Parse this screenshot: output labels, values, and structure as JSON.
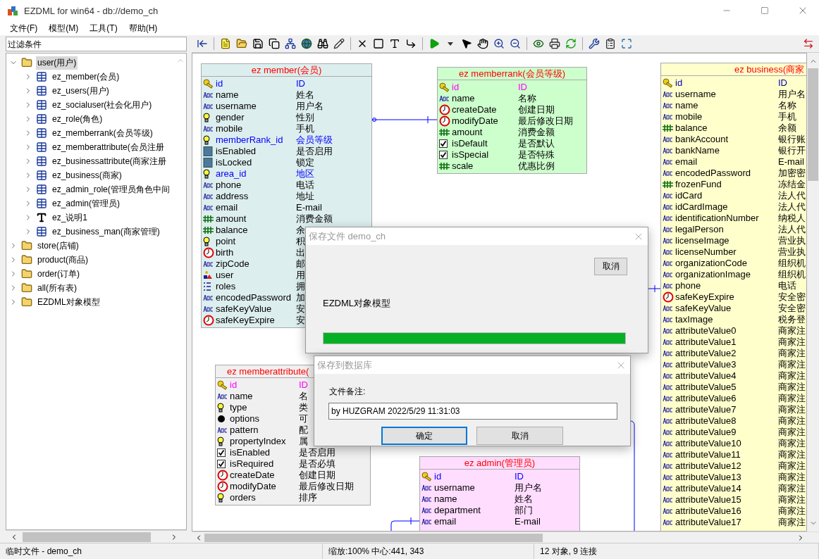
{
  "window": {
    "title": "EZDML for win64 - db://demo_ch"
  },
  "menu": [
    "文件(F)",
    "模型(M)",
    "工具(T)",
    "帮助(H)"
  ],
  "filter": {
    "placeholder": "过滤条件"
  },
  "tree": [
    {
      "label": "user(用户)",
      "kind": "folder",
      "selected": true,
      "expanded": true,
      "children": [
        {
          "label": "ez_member(会员)",
          "kind": "table",
          "selected": false,
          "expanded": false
        },
        {
          "label": "ez_users(用户)",
          "kind": "table",
          "selected": false,
          "expanded": false
        },
        {
          "label": "ez_socialuser(社会化用户)",
          "kind": "table",
          "selected": false,
          "expanded": false
        },
        {
          "label": "ez_role(角色)",
          "kind": "table",
          "selected": false,
          "expanded": false
        },
        {
          "label": "ez_memberrank(会员等级)",
          "kind": "table",
          "selected": false,
          "expanded": false
        },
        {
          "label": "ez_memberattribute(会员注册",
          "kind": "table",
          "selected": false,
          "expanded": false
        },
        {
          "label": "ez_businessattribute(商家注册",
          "kind": "table",
          "selected": false,
          "expanded": false
        },
        {
          "label": "ez_business(商家)",
          "kind": "table",
          "selected": false,
          "expanded": false
        },
        {
          "label": "ez_admin_role(管理员角色中间",
          "kind": "table",
          "selected": false,
          "expanded": false
        },
        {
          "label": "ez_admin(管理员)",
          "kind": "table",
          "selected": false,
          "expanded": false
        },
        {
          "label": "ez_说明1",
          "kind": "text",
          "selected": false,
          "expanded": false
        },
        {
          "label": "ez_business_man(商家管理)",
          "kind": "table",
          "selected": false,
          "expanded": false
        }
      ]
    },
    {
      "label": "store(店铺)",
      "kind": "folder",
      "selected": false,
      "expanded": false
    },
    {
      "label": "product(商品)",
      "kind": "folder",
      "selected": false,
      "expanded": false
    },
    {
      "label": "order(订单)",
      "kind": "folder",
      "selected": false,
      "expanded": false
    },
    {
      "label": "all(所有表)",
      "kind": "folder",
      "selected": false,
      "expanded": false
    },
    {
      "label": "EZDML对象模型",
      "kind": "folder",
      "selected": false,
      "expanded": false
    }
  ],
  "diagram": {
    "tables": [
      {
        "title": "ez member(会员)",
        "color": "#ddeeee",
        "cut_right": false,
        "cut_bottom": false,
        "fields": [
          {
            "name": "id",
            "comment": "ID",
            "kind": "key",
            "color": "#0000ff"
          },
          {
            "name": "name",
            "comment": "姓名",
            "kind": "text",
            "color": "#000000"
          },
          {
            "name": "username",
            "comment": "用户名",
            "kind": "text",
            "color": "#000000"
          },
          {
            "name": "gender",
            "comment": "性别",
            "kind": "bulb",
            "color": "#000000"
          },
          {
            "name": "mobile",
            "comment": "手机",
            "kind": "text",
            "color": "#000000"
          },
          {
            "name": "memberRank_id",
            "comment": "会员等级",
            "kind": "bulb",
            "color": "#0000ff"
          },
          {
            "name": "isEnabled",
            "comment": "是否启用",
            "kind": "bool",
            "color": "#000000"
          },
          {
            "name": "isLocked",
            "comment": "锁定",
            "kind": "bool",
            "color": "#000000"
          },
          {
            "name": "area_id",
            "comment": "地区",
            "kind": "bulb",
            "color": "#0000ff"
          },
          {
            "name": "phone",
            "comment": "电话",
            "kind": "text",
            "color": "#000000"
          },
          {
            "name": "address",
            "comment": "地址",
            "kind": "text",
            "color": "#000000"
          },
          {
            "name": "email",
            "comment": "E-mail",
            "kind": "text",
            "color": "#000000"
          },
          {
            "name": "amount",
            "comment": "消费金额",
            "kind": "number",
            "color": "#000000"
          },
          {
            "name": "balance",
            "comment": "余",
            "kind": "number",
            "color": "#000000"
          },
          {
            "name": "point",
            "comment": "积",
            "kind": "bulb",
            "color": "#000000"
          },
          {
            "name": "birth",
            "comment": "出",
            "kind": "date",
            "color": "#000000"
          },
          {
            "name": "zipCode",
            "comment": "邮",
            "kind": "text",
            "color": "#000000"
          },
          {
            "name": "user",
            "comment": "用",
            "kind": "object",
            "color": "#000000"
          },
          {
            "name": "roles",
            "comment": "拥",
            "kind": "list",
            "color": "#000000"
          },
          {
            "name": "encodedPassword",
            "comment": "加",
            "kind": "text",
            "color": "#000000"
          },
          {
            "name": "safeKeyValue",
            "comment": "安",
            "kind": "text",
            "color": "#000000"
          },
          {
            "name": "safeKeyExpire",
            "comment": "安",
            "kind": "date",
            "color": "#000000"
          }
        ]
      },
      {
        "title": "ez memberrank(会员等级)",
        "color": "#ccffcc",
        "cut_right": false,
        "cut_bottom": false,
        "fields": [
          {
            "name": "id",
            "comment": "ID",
            "kind": "key",
            "color": "#ff00ff"
          },
          {
            "name": "name",
            "comment": "名称",
            "kind": "text",
            "color": "#000000"
          },
          {
            "name": "createDate",
            "comment": "创建日期",
            "kind": "date",
            "color": "#000000"
          },
          {
            "name": "modifyDate",
            "comment": "最后修改日期",
            "kind": "date",
            "color": "#000000"
          },
          {
            "name": "amount",
            "comment": "消费金额",
            "kind": "number",
            "color": "#000000"
          },
          {
            "name": "isDefault",
            "comment": "是否默认",
            "kind": "check",
            "color": "#000000"
          },
          {
            "name": "isSpecial",
            "comment": "是否特殊",
            "kind": "check",
            "color": "#000000"
          },
          {
            "name": "scale",
            "comment": "优惠比例",
            "kind": "number",
            "color": "#000000"
          }
        ]
      },
      {
        "title": "ez business(商家",
        "color": "#ffffcc",
        "cut_right": true,
        "cut_bottom": true,
        "fields": [
          {
            "name": "id",
            "comment": "ID",
            "kind": "key",
            "color": "#0000aa"
          },
          {
            "name": "username",
            "comment": "用户名",
            "kind": "text",
            "color": "#000000"
          },
          {
            "name": "name",
            "comment": "名称",
            "kind": "text",
            "color": "#000000"
          },
          {
            "name": "mobile",
            "comment": "手机",
            "kind": "text",
            "color": "#000000"
          },
          {
            "name": "balance",
            "comment": "余额",
            "kind": "number",
            "color": "#000000"
          },
          {
            "name": "bankAccount",
            "comment": "银行账",
            "kind": "text",
            "color": "#000000"
          },
          {
            "name": "bankName",
            "comment": "银行开",
            "kind": "text",
            "color": "#000000"
          },
          {
            "name": "email",
            "comment": "E-mail",
            "kind": "text",
            "color": "#000000"
          },
          {
            "name": "encodedPassword",
            "comment": "加密密",
            "kind": "text",
            "color": "#000000"
          },
          {
            "name": "frozenFund",
            "comment": "冻结金",
            "kind": "number",
            "color": "#000000"
          },
          {
            "name": "idCard",
            "comment": "法人代",
            "kind": "text",
            "color": "#000000"
          },
          {
            "name": "idCardImage",
            "comment": "法人代",
            "kind": "text",
            "color": "#000000"
          },
          {
            "name": "identificationNumber",
            "comment": "纳税人",
            "kind": "text",
            "color": "#000000"
          },
          {
            "name": "legalPerson",
            "comment": "法人代",
            "kind": "text",
            "color": "#000000"
          },
          {
            "name": "licenseImage",
            "comment": "营业执",
            "kind": "text",
            "color": "#000000"
          },
          {
            "name": "licenseNumber",
            "comment": "营业执",
            "kind": "text",
            "color": "#000000"
          },
          {
            "name": "organizationCode",
            "comment": "组织机",
            "kind": "text",
            "color": "#000000"
          },
          {
            "name": "organizationImage",
            "comment": "组织机",
            "kind": "text",
            "color": "#000000"
          },
          {
            "name": "phone",
            "comment": "电话",
            "kind": "text",
            "color": "#000000"
          },
          {
            "name": "safeKeyExpire",
            "comment": "安全密",
            "kind": "date",
            "color": "#000000"
          },
          {
            "name": "safeKeyValue",
            "comment": "安全密",
            "kind": "text",
            "color": "#000000"
          },
          {
            "name": "taxImage",
            "comment": "税务登",
            "kind": "text",
            "color": "#000000"
          },
          {
            "name": "attributeValue0",
            "comment": "商家注",
            "kind": "text",
            "color": "#000000"
          },
          {
            "name": "attributeValue1",
            "comment": "商家注",
            "kind": "text",
            "color": "#000000"
          },
          {
            "name": "attributeValue2",
            "comment": "商家注",
            "kind": "text",
            "color": "#000000"
          },
          {
            "name": "attributeValue3",
            "comment": "商家注",
            "kind": "text",
            "color": "#000000"
          },
          {
            "name": "attributeValue4",
            "comment": "商家注",
            "kind": "text",
            "color": "#000000"
          },
          {
            "name": "attributeValue5",
            "comment": "商家注",
            "kind": "text",
            "color": "#000000"
          },
          {
            "name": "attributeValue6",
            "comment": "商家注",
            "kind": "text",
            "color": "#000000"
          },
          {
            "name": "attributeValue7",
            "comment": "商家注",
            "kind": "text",
            "color": "#000000"
          },
          {
            "name": "attributeValue8",
            "comment": "商家注",
            "kind": "text",
            "color": "#000000"
          },
          {
            "name": "attributeValue9",
            "comment": "商家注",
            "kind": "text",
            "color": "#000000"
          },
          {
            "name": "attributeValue10",
            "comment": "商家注",
            "kind": "text",
            "color": "#000000"
          },
          {
            "name": "attributeValue11",
            "comment": "商家注",
            "kind": "text",
            "color": "#000000"
          },
          {
            "name": "attributeValue12",
            "comment": "商家注",
            "kind": "text",
            "color": "#000000"
          },
          {
            "name": "attributeValue13",
            "comment": "商家注",
            "kind": "text",
            "color": "#000000"
          },
          {
            "name": "attributeValue14",
            "comment": "商家注",
            "kind": "text",
            "color": "#000000"
          },
          {
            "name": "attributeValue15",
            "comment": "商家注",
            "kind": "text",
            "color": "#000000"
          },
          {
            "name": "attributeValue16",
            "comment": "商家注",
            "kind": "text",
            "color": "#000000"
          },
          {
            "name": "attributeValue17",
            "comment": "商家注",
            "kind": "text",
            "color": "#000000"
          }
        ]
      },
      {
        "title": "ez memberattribute(",
        "color": "#f0f0f0",
        "cut_right": false,
        "cut_bottom": false,
        "fields": [
          {
            "name": "id",
            "comment": "ID",
            "kind": "key",
            "color": "#ff00ff"
          },
          {
            "name": "name",
            "comment": "名",
            "kind": "text",
            "color": "#000000"
          },
          {
            "name": "type",
            "comment": "类",
            "kind": "bulb",
            "color": "#000000"
          },
          {
            "name": "options",
            "comment": "可",
            "kind": "dot",
            "color": "#000000"
          },
          {
            "name": "pattern",
            "comment": "配",
            "kind": "text",
            "color": "#000000"
          },
          {
            "name": "propertyIndex",
            "comment": "属",
            "kind": "bulb",
            "color": "#000000"
          },
          {
            "name": "isEnabled",
            "comment": "是否启用",
            "kind": "check",
            "color": "#000000"
          },
          {
            "name": "isRequired",
            "comment": "是否必填",
            "kind": "check",
            "color": "#000000"
          },
          {
            "name": "createDate",
            "comment": "创建日期",
            "kind": "date",
            "color": "#000000"
          },
          {
            "name": "modifyDate",
            "comment": "最后修改日期",
            "kind": "date",
            "color": "#000000"
          },
          {
            "name": "orders",
            "comment": "排序",
            "kind": "bulb",
            "color": "#000000"
          }
        ]
      },
      {
        "title": "ez admin(管理员)",
        "color": "#ffddff",
        "cut_right": false,
        "cut_bottom": true,
        "fields": [
          {
            "name": "id",
            "comment": "ID",
            "kind": "key",
            "color": "#0000ff"
          },
          {
            "name": "username",
            "comment": "用户名",
            "kind": "text",
            "color": "#000000"
          },
          {
            "name": "name",
            "comment": "姓名",
            "kind": "text",
            "color": "#000000"
          },
          {
            "name": "department",
            "comment": "部门",
            "kind": "text",
            "color": "#000000"
          },
          {
            "name": "email",
            "comment": "E-mail",
            "kind": "text",
            "color": "#000000"
          }
        ]
      }
    ]
  },
  "progress_dialog": {
    "title": "保存文件 demo_ch",
    "cancel": "取消",
    "message": "EZDML对象模型",
    "level": 1
  },
  "db_dialog": {
    "title": "保存到数据库",
    "label": "文件备注:",
    "value": "by HUZGRAM 2022/5/29 11:31:03",
    "ok": "确定",
    "cancel": "取消"
  },
  "status_bar": [
    "临时文件 - demo_ch",
    "缩放:100% 中心:441, 343",
    "12 对象, 9 连接"
  ]
}
